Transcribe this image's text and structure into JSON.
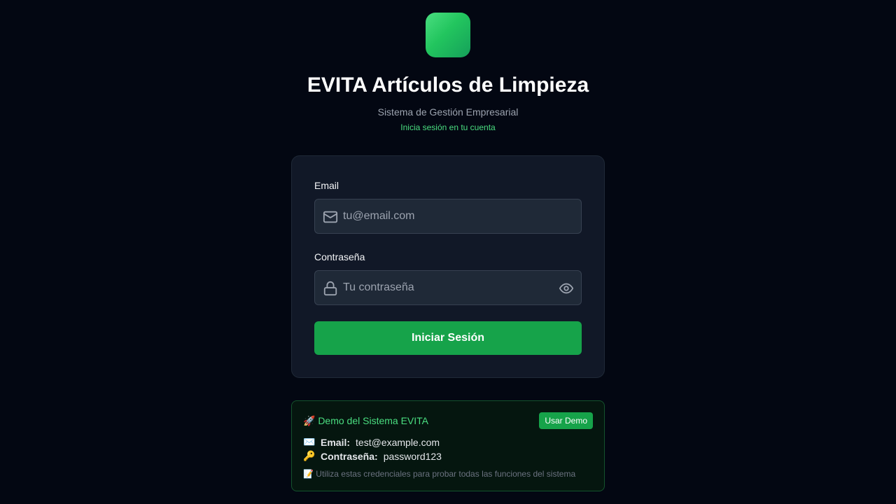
{
  "brand": {
    "title": "EVITA Artículos de Limpieza",
    "subtitle": "Sistema de Gestión Empresarial",
    "tagline": "Inicia sesión en tu cuenta",
    "accent": "#22c55e"
  },
  "form": {
    "email_label": "Email",
    "email_placeholder": "tu@email.com",
    "email_value": "",
    "password_label": "Contraseña",
    "password_placeholder": "Tu contraseña",
    "password_value": "",
    "submit_label": "Iniciar Sesión",
    "icons": [
      "mail-icon",
      "lock-icon",
      "eye-icon"
    ]
  },
  "demo": {
    "title": "🚀 Demo del Sistema EVITA",
    "button_label": "Usar Demo",
    "email_emoji": "✉️",
    "email_key": "Email:",
    "email_value": "test@example.com",
    "password_emoji": "🔑",
    "password_key": "Contraseña:",
    "password_value": "password123",
    "note": "📝 Utiliza estas credenciales para probar todas las funciones del sistema"
  }
}
